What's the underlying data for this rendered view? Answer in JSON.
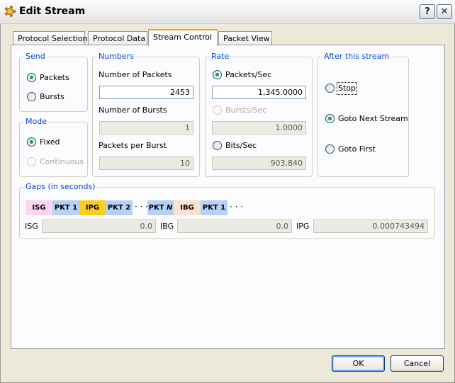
{
  "window": {
    "title": "Edit Stream",
    "help_label": "?",
    "close_label": "✕"
  },
  "tabs": [
    {
      "label": "Protocol Selection",
      "active": false
    },
    {
      "label": "Protocol Data",
      "active": false
    },
    {
      "label": "Stream Control",
      "active": true
    },
    {
      "label": "Packet View",
      "active": false
    }
  ],
  "send": {
    "legend": "Send",
    "packets_label": "Packets",
    "bursts_label": "Bursts",
    "selected": "Packets"
  },
  "mode": {
    "legend": "Mode",
    "fixed_label": "Fixed",
    "continuous_label": "Continuous",
    "selected": "Fixed"
  },
  "numbers": {
    "legend": "Numbers",
    "num_packets_label": "Number of Packets",
    "num_packets_value": "2453",
    "num_bursts_label": "Number of Bursts",
    "num_bursts_value": "1",
    "packets_per_burst_label": "Packets per Burst",
    "packets_per_burst_value": "10"
  },
  "rate": {
    "legend": "Rate",
    "packets_sec_label": "Packets/Sec",
    "packets_sec_value": "1,345.0000",
    "bursts_sec_label": "Bursts/Sec",
    "bursts_sec_value": "1.0000",
    "bits_sec_label": "Bits/Sec",
    "bits_sec_value": "903,840",
    "selected": "Packets/Sec"
  },
  "after": {
    "legend": "After this stream",
    "stop_label": "Stop",
    "goto_next_label": "Goto Next Stream",
    "goto_first_label": "Goto First",
    "selected": "Goto Next Stream"
  },
  "gaps": {
    "legend": "Gaps (in seconds)",
    "diagram": [
      {
        "label": "ISG",
        "color": "#fbd5f2"
      },
      {
        "label": "PKT 1",
        "color": "#b7d0f5"
      },
      {
        "label": "IPG",
        "color": "#fbcd1e"
      },
      {
        "label": "PKT 2",
        "color": "#b7d0f5"
      },
      {
        "label": "PKT N",
        "color": "#b7d0f5"
      },
      {
        "label": "IBG",
        "color": "#fbe1d0"
      },
      {
        "label": "PKT 1",
        "color": "#b7d0f5"
      }
    ],
    "dots": "· · ·",
    "isg_label": "ISG",
    "isg_value": "0.0",
    "ibg_label": "IBG",
    "ibg_value": "0.0",
    "ipg_label": "IPG",
    "ipg_value": "0.000743494"
  },
  "buttons": {
    "ok_label": "OK",
    "cancel_label": "Cancel"
  }
}
